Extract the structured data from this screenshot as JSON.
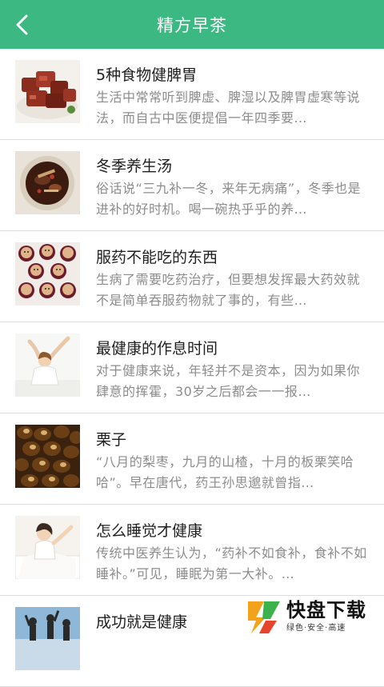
{
  "header": {
    "title": "精方早茶",
    "back_icon": "chevron-left-icon",
    "color": "#3cb883"
  },
  "articles": [
    {
      "title": "5种食物健脾胃",
      "desc": "生活中常常听到脾虚、脾湿以及脾胃虚寒等说法，而自古中医便提倡一年四季要…",
      "thumb": "braised-meat-image"
    },
    {
      "title": "冬季养生汤",
      "desc": "俗话说“三九补一冬，来年无病痛”，冬季也是进补的好时机。喝一碗热乎乎的养…",
      "thumb": "soup-bowl-image"
    },
    {
      "title": "服药不能吃的东西",
      "desc": "生病了需要吃药治疗，但要想发挥最大药效就不是简单吞服药物就了事的，有些…",
      "thumb": "cupcakes-image"
    },
    {
      "title": "最健康的作息时间",
      "desc": "对于健康来说，年轻并不是资本，因为如果你肆意的挥霍，30岁之后都会一一报…",
      "thumb": "woman-stretching-image"
    },
    {
      "title": "栗子",
      "desc": "“八月的梨枣，九月的山楂，十月的板栗笑哈哈”。早在唐代，药王孙思邈就曾指…",
      "thumb": "chestnuts-image"
    },
    {
      "title": "怎么睡觉才健康",
      "desc": "传统中医养生认为，“药补不如食补，食补不如睡补。”可见，睡眠为第一大补。…",
      "thumb": "woman-waking-image"
    },
    {
      "title": "成功就是健康",
      "desc": "",
      "thumb": "silhouettes-image"
    }
  ],
  "watermark": {
    "brand": "快盘下载",
    "tagline": "绿色·安全·高速"
  }
}
